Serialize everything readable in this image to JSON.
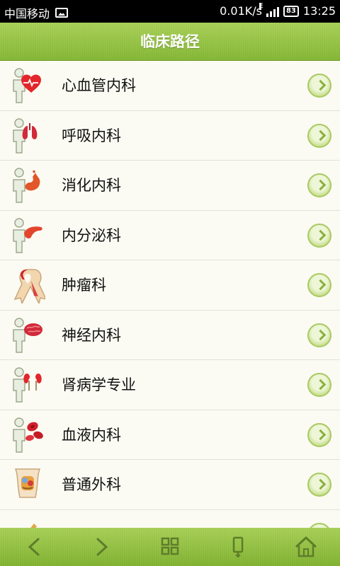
{
  "status_bar": {
    "carrier": "中国移动",
    "speed": "0.01K/s",
    "network_type": "E",
    "battery": "83",
    "time": "13:25"
  },
  "header": {
    "title": "临床路径"
  },
  "departments": [
    {
      "label": "心血管内科",
      "icon": "heart-icon"
    },
    {
      "label": "呼吸内科",
      "icon": "lungs-icon"
    },
    {
      "label": "消化内科",
      "icon": "stomach-icon"
    },
    {
      "label": "内分泌科",
      "icon": "pancreas-icon"
    },
    {
      "label": "肿瘤科",
      "icon": "ribbon-icon"
    },
    {
      "label": "神经内科",
      "icon": "brain-icon"
    },
    {
      "label": "肾病学专业",
      "icon": "kidney-icon"
    },
    {
      "label": "血液内科",
      "icon": "blood-cells-icon"
    },
    {
      "label": "普通外科",
      "icon": "abdomen-icon"
    },
    {
      "label": "",
      "icon": "partial-icon"
    }
  ],
  "bottom_nav": [
    {
      "name": "back",
      "icon": "chevron-left-icon"
    },
    {
      "name": "forward",
      "icon": "chevron-right-icon"
    },
    {
      "name": "grid",
      "icon": "grid-icon"
    },
    {
      "name": "phone",
      "icon": "phone-icon"
    },
    {
      "name": "home",
      "icon": "home-icon"
    }
  ],
  "colors": {
    "accent": "#8fbd3e",
    "header_text": "#ffffff",
    "row_bg": "#fbfbf3"
  }
}
